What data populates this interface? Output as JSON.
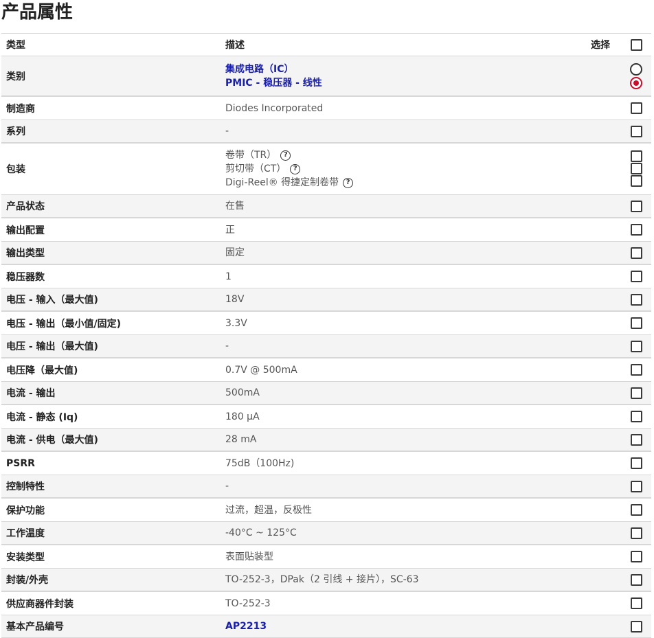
{
  "page_title": "产品属性",
  "header": {
    "type": "类型",
    "description": "描述",
    "select": "选择"
  },
  "rows": [
    {
      "label": "类别",
      "values": [
        "集成电路（IC）",
        "PMIC - 稳压器 - 线性"
      ],
      "links": true,
      "control": "radio"
    },
    {
      "label": "制造商",
      "values": [
        "Diodes Incorporated"
      ]
    },
    {
      "label": "系列",
      "values": [
        "-"
      ]
    },
    {
      "label": "包装",
      "values": [
        "卷带（TR）",
        "剪切带（CT）",
        "Digi-Reel® 得捷定制卷带"
      ],
      "help": true
    },
    {
      "label": "产品状态",
      "values": [
        "在售"
      ]
    },
    {
      "label": "输出配置",
      "values": [
        "正"
      ]
    },
    {
      "label": "输出类型",
      "values": [
        "固定"
      ]
    },
    {
      "label": "稳压器数",
      "values": [
        "1"
      ]
    },
    {
      "label": "电压 - 输入（最大值)",
      "values": [
        "18V"
      ]
    },
    {
      "label": "电压 - 输出（最小值/固定)",
      "values": [
        "3.3V"
      ]
    },
    {
      "label": "电压 - 输出（最大值)",
      "values": [
        "-"
      ]
    },
    {
      "label": "电压降（最大值)",
      "values": [
        "0.7V @ 500mA"
      ]
    },
    {
      "label": "电流 - 输出",
      "values": [
        "500mA"
      ]
    },
    {
      "label": "电流 - 静态 (Iq)",
      "values": [
        "180 µA"
      ]
    },
    {
      "label": "电流 - 供电（最大值)",
      "values": [
        "28 mA"
      ]
    },
    {
      "label": "PSRR",
      "values": [
        "75dB（100Hz)"
      ]
    },
    {
      "label": "控制特性",
      "values": [
        "-"
      ]
    },
    {
      "label": "保护功能",
      "values": [
        "过流，超温，反极性"
      ]
    },
    {
      "label": "工作温度",
      "values": [
        "-40°C ~ 125°C"
      ]
    },
    {
      "label": "安装类型",
      "values": [
        "表面贴装型"
      ]
    },
    {
      "label": "封装/外壳",
      "values": [
        "TO-252-3，DPak（2 引线 + 接片），SC-63"
      ]
    },
    {
      "label": "供应商器件封装",
      "values": [
        "TO-252-3"
      ]
    },
    {
      "label": "基本产品编号",
      "values": [
        "AP2213"
      ],
      "links": true
    }
  ],
  "help_icon": "question-circle-icon",
  "colors": {
    "link": "#1a1fa8",
    "radio_selected": "#c8102e",
    "alt_row": "#f4f4f4"
  }
}
